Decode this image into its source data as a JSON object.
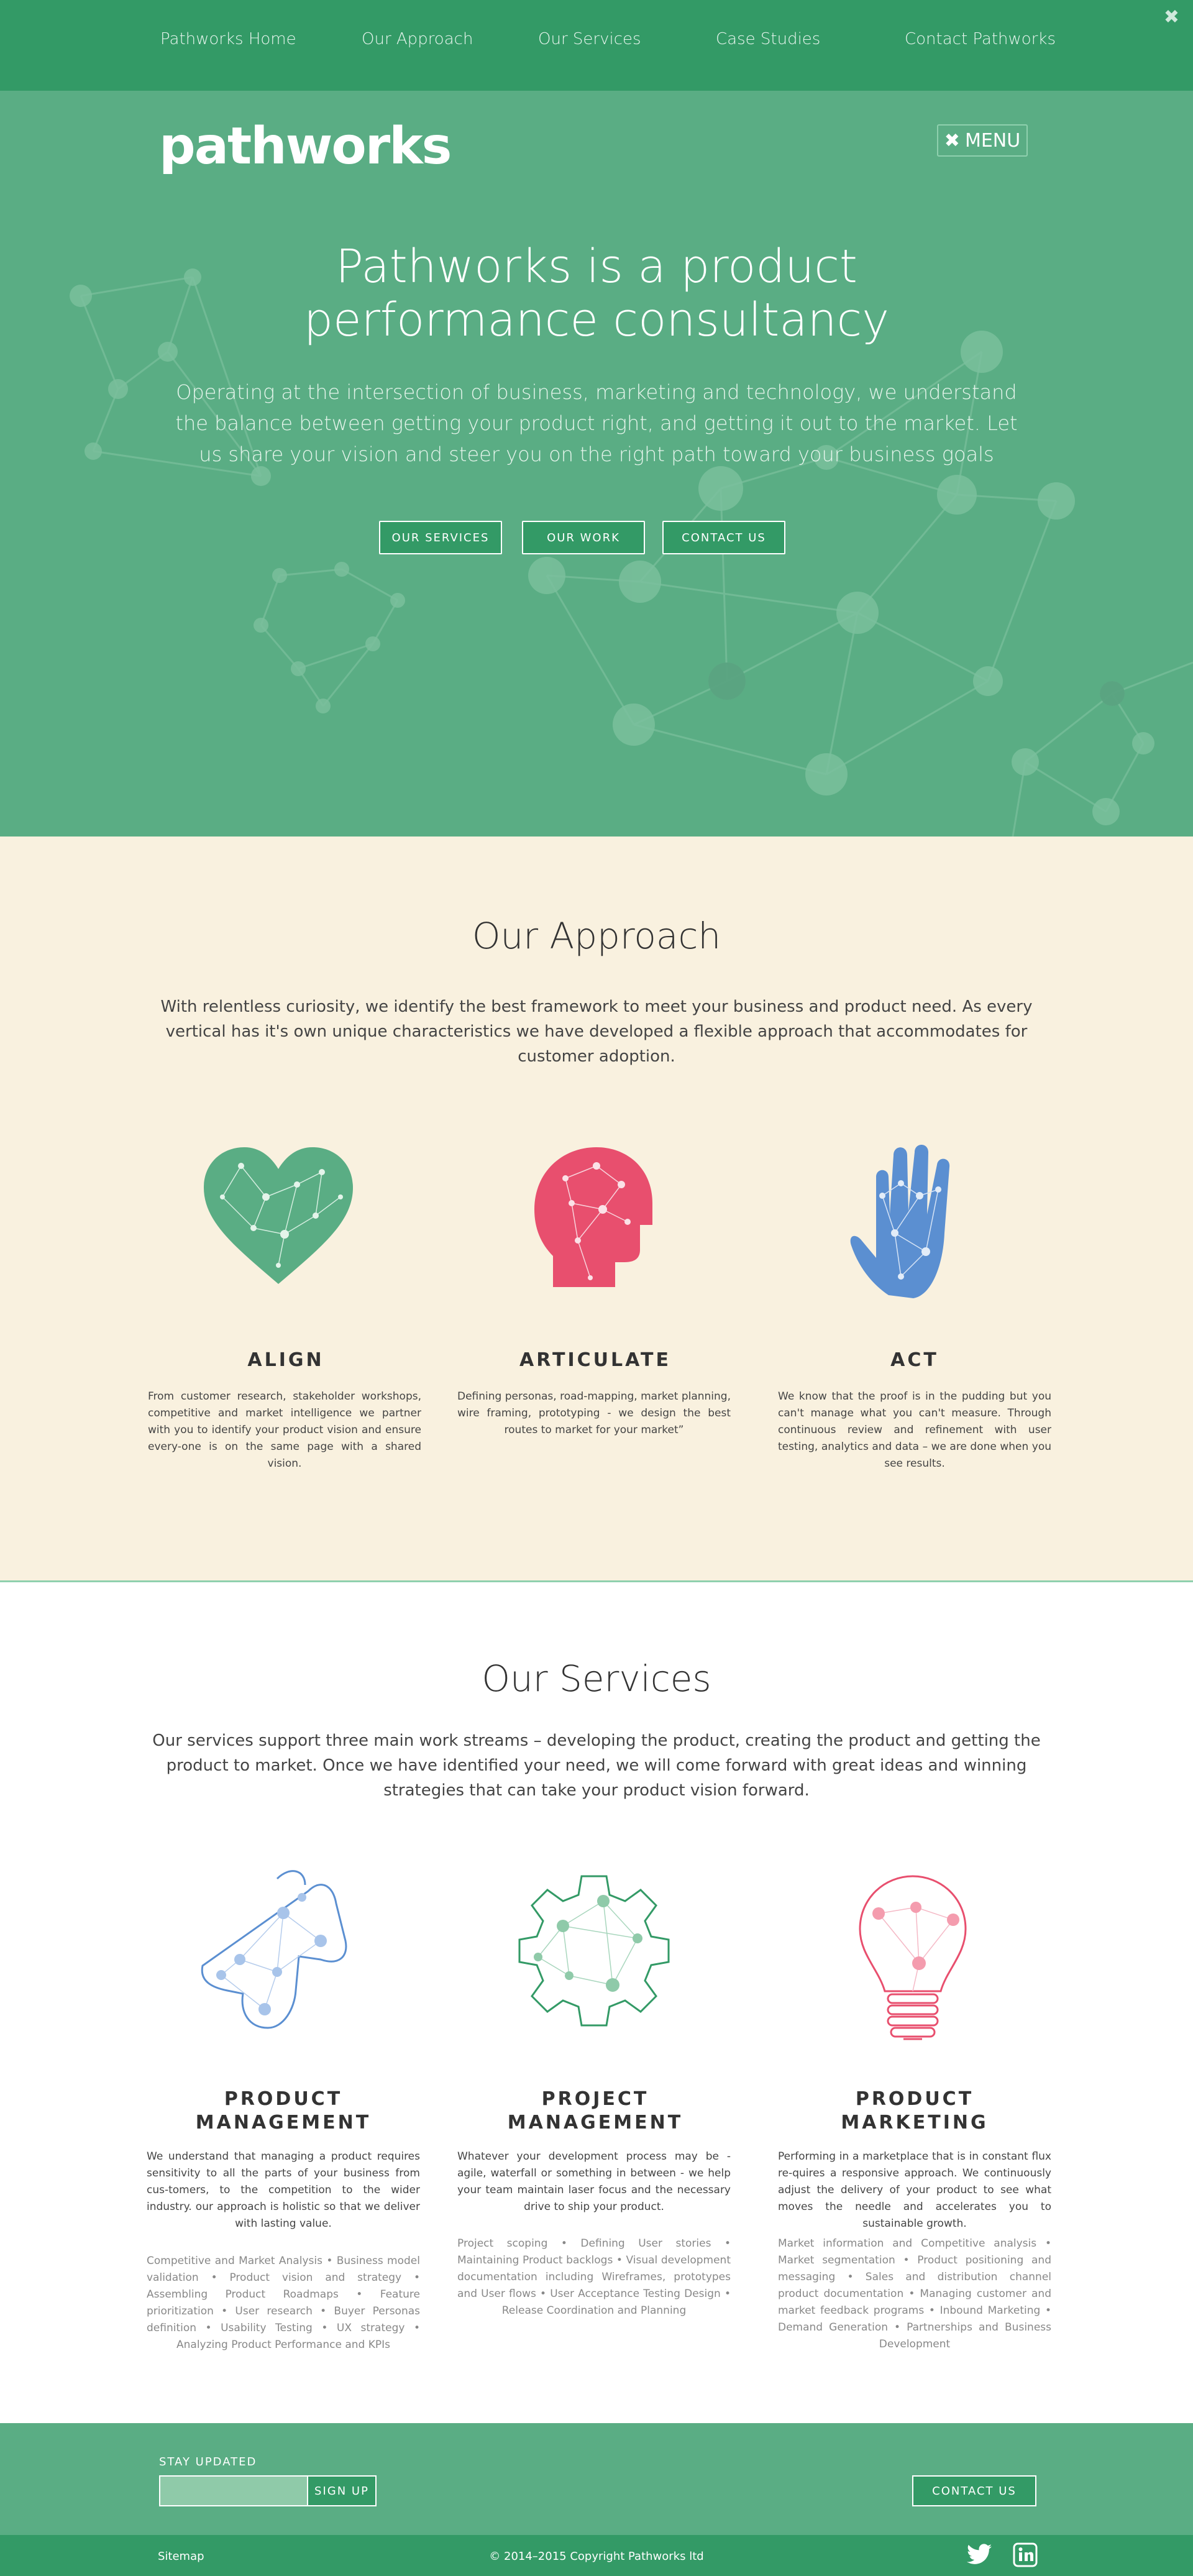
{
  "nav": {
    "items": [
      "Pathworks Home",
      "Our Approach",
      "Our Services",
      "Case Studies",
      "Contact Pathworks"
    ],
    "close": "✖"
  },
  "hero": {
    "logo": "pathworks",
    "menu_label": "MENU",
    "menu_icon": "✖",
    "title": "Pathworks is a product performance consultancy",
    "text": "Operating at the intersection of business, marketing and technology, we understand the balance between getting your product right, and getting it out to the market. Let us share your vision and steer you on the right path toward your business goals",
    "buttons": [
      "OUR SERVICES",
      "OUR WORK",
      "CONTACT US"
    ]
  },
  "approach": {
    "title": "Our Approach",
    "text": "With relentless curiosity, we identify the best framework to meet your business  and product need. As every vertical has it's own unique characteristics we have developed a flexible approach that accommodates for customer adoption.",
    "columns": [
      {
        "title": "ALIGN",
        "text": "From customer research, stakeholder workshops, competitive and market intelligence we partner with you to identify your product vision and ensure every-one is on the same page with a shared vision.",
        "icon": "heart-network-icon",
        "color": "#5aad84"
      },
      {
        "title": "ARTICULATE",
        "text": "Defining personas, road-mapping, market planning, wire framing, prototyping - we design the best routes to market for your market”",
        "icon": "head-network-icon",
        "color": "#e84f6e"
      },
      {
        "title": "ACT",
        "text": "We know that the proof is in the pudding but you can't manage what you can't measure.  Through continuous review and refinement with user testing, analytics and data – we are done when you see results.",
        "icon": "hand-network-icon",
        "color": "#5b8fd1"
      }
    ]
  },
  "services": {
    "title": "Our Services",
    "text": "Our services support three main work streams – developing the product, creating the product and getting the product to market. Once we have identified your need, we will come forward with great ideas and winning strategies that can take your product vision forward.",
    "columns": [
      {
        "title_line1": "PRODUCT",
        "title_line2": "MANAGEMENT",
        "text": "We understand that managing a product requires sensitivity to all the parts of your business from cus-tomers, to the competition to the wider industry. our approach is holistic so that we deliver with lasting value.",
        "sub": "Competitive and Market Analysis • Business model validation • Product vision and strategy • Assembling Product Roadmaps • Feature prioritization • User research • Buyer Personas definition • Usability Testing • UX strategy • Analyzing Product Performance and KPIs",
        "icon": "megaphone-icon",
        "color": "#5b8fd1"
      },
      {
        "title_line1": "PROJECT",
        "title_line2": "MANAGEMENT",
        "text": "Whatever your development process may be - agile, waterfall or something in between - we help your team maintain laser focus and the necessary drive to ship your product.",
        "sub": "Project scoping • Defining User stories • Maintaining Product backlogs • Visual development documentation including Wireframes, prototypes and User flows • User Acceptance Testing Design • Release Coordination and Planning",
        "icon": "gear-icon",
        "color": "#339a66"
      },
      {
        "title_line1": "PRODUCT",
        "title_line2": "MARKETING",
        "text": "Performing in a marketplace that is in constant flux re-quires a responsive approach.  We continuously adjust the delivery of your product to see what moves the needle and accelerates you to sustainable growth.",
        "sub": "Market information and Competitive analysis • Market segmentation • Product positioning and messaging • Sales and distribution channel product documentation • Managing customer and market feedback programs • Inbound Marketing • Demand Generation • Partnerships and Business Development",
        "icon": "lightbulb-icon",
        "color": "#e84f6e"
      }
    ]
  },
  "footer": {
    "stay_updated": "STAY UPDATED",
    "email_placeholder": "",
    "signup": "SIGN UP",
    "contact": "CONTACT US",
    "sitemap": "Sitemap",
    "copyright": "© 2014–2015 Copyright Pathworks ltd",
    "social": [
      "twitter-icon",
      "linkedin-icon"
    ]
  },
  "colors": {
    "nav_green": "#339a66",
    "hero_green": "#5aad84",
    "cream": "#f9f1df",
    "pink": "#e84f6e",
    "blue": "#5b8fd1"
  }
}
